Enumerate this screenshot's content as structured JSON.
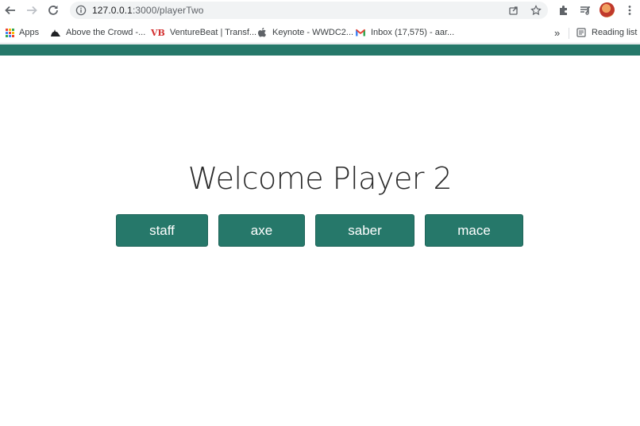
{
  "browser": {
    "url_host": "127.0.0.1",
    "url_path": ":3000/playerTwo"
  },
  "bookmarks": {
    "items": [
      {
        "label": "Apps",
        "icon": "apps-grid-icon"
      },
      {
        "label": "Above the Crowd -...",
        "icon": "above-the-crowd-favicon"
      },
      {
        "label": "VentureBeat | Transf...",
        "icon": "venturebeat-favicon",
        "icon_text": "VB"
      },
      {
        "label": "Keynote - WWDC2...",
        "icon": "apple-favicon"
      },
      {
        "label": "Inbox (17,575) - aar...",
        "icon": "gmail-favicon"
      }
    ],
    "overflow_label": "»",
    "reading_list_label": "Reading list"
  },
  "page": {
    "title": "Welcome Player 2",
    "buttons": [
      {
        "label": "staff"
      },
      {
        "label": "axe"
      },
      {
        "label": "saber"
      },
      {
        "label": "mace"
      }
    ]
  },
  "colors": {
    "accent": "#26786a",
    "button_text": "#ffffff"
  }
}
